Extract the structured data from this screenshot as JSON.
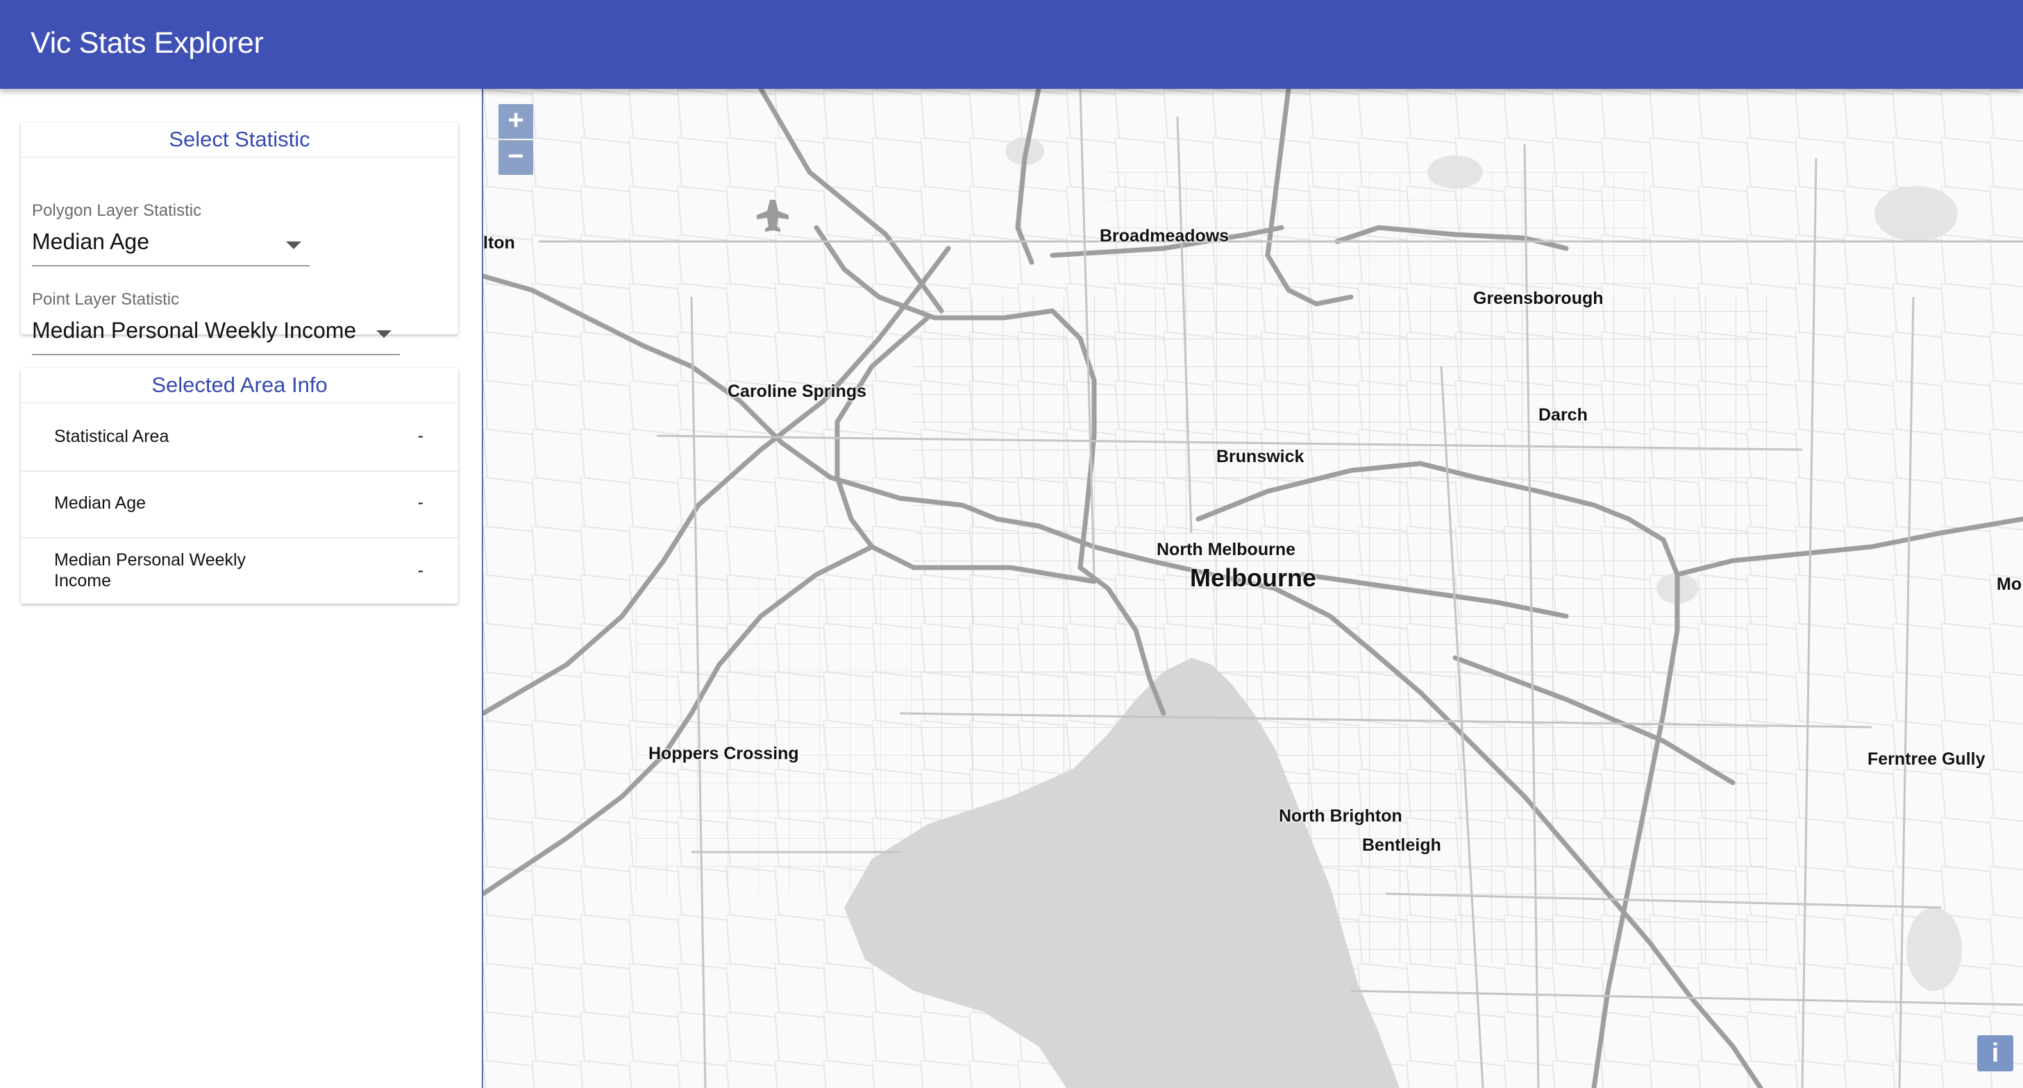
{
  "app": {
    "title": "Vic Stats Explorer"
  },
  "select_statistic": {
    "title": "Select Statistic",
    "polygon_label": "Polygon Layer Statistic",
    "polygon_value": "Median Age",
    "point_label": "Point Layer Statistic",
    "point_value": "Median Personal Weekly Income"
  },
  "area_info": {
    "title": "Selected Area Info",
    "rows": [
      {
        "label": "Statistical Area",
        "value": "-"
      },
      {
        "label": "Median Age",
        "value": "-"
      },
      {
        "label": "Median Personal Weekly Income",
        "value": "-"
      }
    ]
  },
  "map": {
    "zoom_in": "+",
    "zoom_out": "−",
    "info": "i",
    "places": {
      "melton": "lton",
      "broadmeadows": "Broadmeadows",
      "greensborough": "Greensborough",
      "caroline_springs": "Caroline Springs",
      "darch": "Darch",
      "brunswick": "Brunswick",
      "north_melbourne": "North Melbourne",
      "melbourne": "Melbourne",
      "mo": "Mo",
      "hoppers_crossing": "Hoppers Crossing",
      "ferntree_gully": "Ferntree Gully",
      "north_brighton": "North Brighton",
      "bentleigh": "Bentleigh"
    }
  },
  "colors": {
    "appbar": "#3f51b5",
    "accent_text": "#3549b0",
    "bay": "#d6d6d6",
    "motorway": "#9e9e9e"
  }
}
